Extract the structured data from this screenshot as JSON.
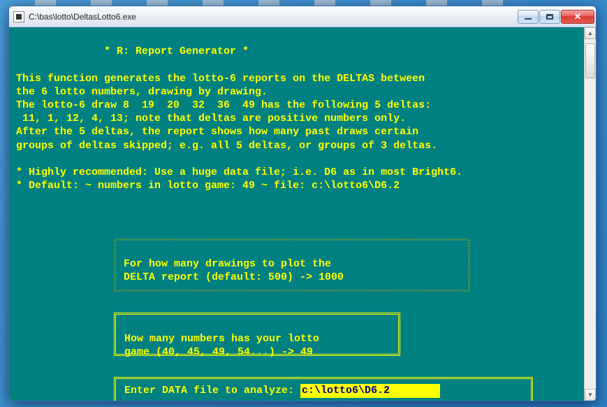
{
  "window": {
    "title": "C:\\bas\\lotto\\DeltasLotto6.exe"
  },
  "header": {
    "title_line": "              * R: Report Generator *",
    "line1": "This function generates the lotto-6 reports on the DELTAS between",
    "line2": "the 6 lotto numbers, drawing by drawing.",
    "line3": "The lotto-6 draw 8  19  20  32  36  49 has the following 5 deltas:",
    "line4": " 11, 1, 12, 4, 13; note that deltas are positive numbers only.",
    "line5": "After the 5 deltas, the report shows how many past draws certain",
    "line6": "groups of deltas skipped; e.g. all 5 deltas, or groups of 3 deltas."
  },
  "notes": {
    "rec": "* Highly recommended: Use a huge data file; i.e. D6 as in most Bright6.",
    "def": "* Default: ~ numbers in lotto game: 49 ~ file: c:\\lotto6\\D6.2"
  },
  "prompt1": {
    "l1": "For how many drawings to plot the",
    "l2_label": "DELTA report (default: 500) -> ",
    "l2_value": "1000"
  },
  "prompt2": {
    "l1": "How many numbers has your lotto",
    "l2_label": "game (40, 45, 49, 54...) -> ",
    "l2_value": "49"
  },
  "prompt3": {
    "label": "Enter DATA file to analyze: ",
    "value": "c:\\lotto6\\D6.2"
  }
}
